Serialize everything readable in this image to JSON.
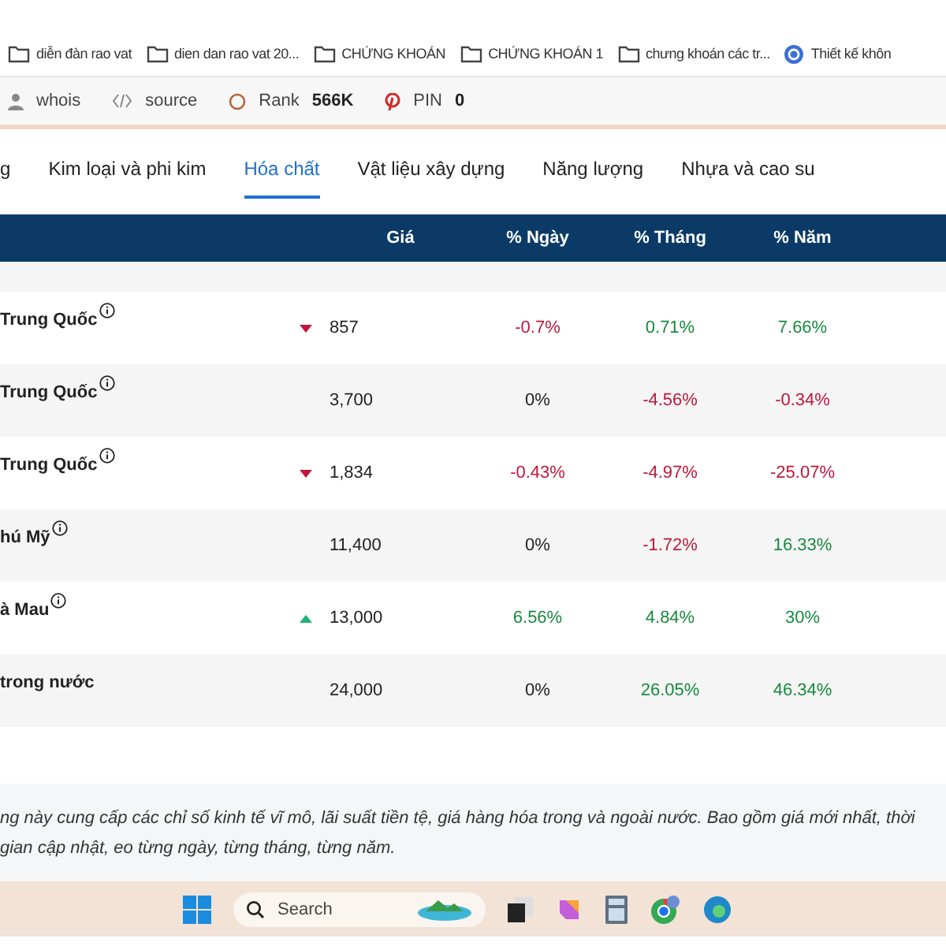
{
  "bookmarks": [
    {
      "label": "diễn đàn rao vat",
      "kind": "folder"
    },
    {
      "label": "dien dan rao vat 20...",
      "kind": "folder"
    },
    {
      "label": "CHỨNG KHOÁN",
      "kind": "folder"
    },
    {
      "label": "CHỨNG KHOÁN 1",
      "kind": "folder"
    },
    {
      "label": "chưng khoán các tr...",
      "kind": "folder"
    },
    {
      "label": "Thiết kế khôn",
      "kind": "site"
    }
  ],
  "seo_bar": [
    {
      "kind": "user",
      "label": "whois"
    },
    {
      "kind": "code",
      "label": "source"
    },
    {
      "kind": "rank",
      "label": "Rank",
      "value": "566K"
    },
    {
      "kind": "pin",
      "label": "PIN",
      "value": "0"
    }
  ],
  "tabs": [
    {
      "label": "g",
      "selected": false
    },
    {
      "label": "Kim loại và phi kim",
      "selected": false
    },
    {
      "label": "Hóa chất",
      "selected": true
    },
    {
      "label": "Vật liệu xây dựng",
      "selected": false
    },
    {
      "label": "Năng lượng",
      "selected": false
    },
    {
      "label": "Nhựa và cao su",
      "selected": false
    }
  ],
  "table": {
    "columns": [
      "Giá",
      "% Ngày",
      "% Tháng",
      "% Năm"
    ],
    "rows": [
      {
        "name": "Trung Quốc",
        "info": true,
        "kind": "falling",
        "price": "857",
        "changes": [
          {
            "text": "-0.7%",
            "color": "#c0163c"
          },
          {
            "text": "0.71%",
            "color": "#178a3e"
          },
          {
            "text": "7.66%",
            "color": "#178a3e"
          }
        ]
      },
      {
        "name": "Trung Quốc",
        "info": true,
        "kind": "steady",
        "price": "3,700",
        "changes": [
          {
            "text": "0%",
            "color": "#222222"
          },
          {
            "text": "-4.56%",
            "color": "#c0163c"
          },
          {
            "text": "-0.34%",
            "color": "#c0163c"
          }
        ]
      },
      {
        "name": "Trung Quốc",
        "info": true,
        "kind": "falling",
        "price": "1,834",
        "changes": [
          {
            "text": "-0.43%",
            "color": "#c0163c"
          },
          {
            "text": "-4.97%",
            "color": "#c0163c"
          },
          {
            "text": "-25.07%",
            "color": "#c0163c"
          }
        ]
      },
      {
        "name": "hú Mỹ",
        "info": true,
        "kind": "steady",
        "price": "11,400",
        "changes": [
          {
            "text": "0%",
            "color": "#222222"
          },
          {
            "text": "-1.72%",
            "color": "#c0163c"
          },
          {
            "text": "16.33%",
            "color": "#178a3e"
          }
        ]
      },
      {
        "name": "à Mau",
        "info": true,
        "kind": "rising",
        "price": "13,000",
        "changes": [
          {
            "text": "6.56%",
            "color": "#178a3e"
          },
          {
            "text": "4.84%",
            "color": "#178a3e"
          },
          {
            "text": "30%",
            "color": "#178a3e"
          }
        ]
      },
      {
        "name": "trong nước",
        "kind": "steady",
        "price": "24,000",
        "changes": [
          {
            "text": "0%",
            "color": "#222222"
          },
          {
            "text": "26.05%",
            "color": "#178a3e"
          },
          {
            "text": "46.34%",
            "color": "#178a3e"
          }
        ]
      }
    ]
  },
  "description": "ng này cung cấp các chỉ số kinh tế vĩ mô, lãi suất tiền tệ, giá hàng hóa trong và ngoài nước. Bao gồm giá mới nhất, thời gian cập nhật, eo từng ngày, từng tháng, từng năm.",
  "taskbar": {
    "search_placeholder": "Search"
  }
}
